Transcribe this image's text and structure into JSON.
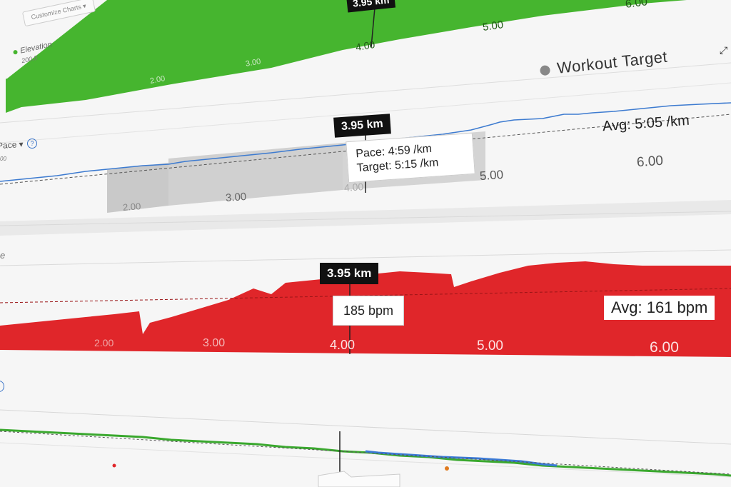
{
  "elevation": {
    "label": "Elevation",
    "sub_value": "200.0",
    "customize_button": "Customize Charts ▾",
    "x_ticks": [
      "2.00",
      "3.00",
      "4.00",
      "5.00",
      "6.00"
    ],
    "cursor_tag": "3.95 km",
    "fill_color": "#46b52f"
  },
  "legend": {
    "workout_target": "Workout Target"
  },
  "pace": {
    "label": "Pace ▾",
    "sub_value": "00",
    "cursor_tag": "3.95 km",
    "tooltip_line1": "Pace: 4:59 /km",
    "tooltip_line2": "Target: 5:15 /km",
    "avg_label": "Avg: 5:05 /km",
    "x_ticks": [
      "2.00",
      "3.00",
      "4.00",
      "5.00",
      "6.00"
    ],
    "line_color": "#3d7bd0"
  },
  "heart_rate": {
    "label": "e",
    "cursor_tag": "3.95 km",
    "tooltip": "185 bpm",
    "avg_label": "Avg: 161 bpm",
    "x_ticks": [
      "2.00",
      "3.00",
      "4.00",
      "5.00",
      "6.00"
    ],
    "fill_color": "#e0262a"
  },
  "cadence": {
    "line_color": "#3aa82e",
    "accent_color": "#3b7ad6"
  }
}
